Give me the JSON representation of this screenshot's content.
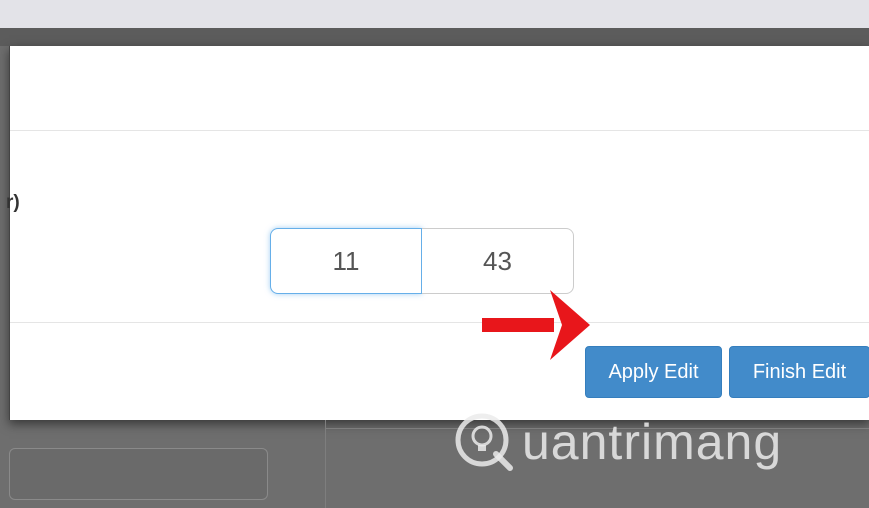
{
  "modal": {
    "side_label": "r)",
    "inputs": [
      {
        "value": "11"
      },
      {
        "value": "43"
      }
    ],
    "buttons": {
      "apply_label": "Apply Edit",
      "finish_label": "Finish Edit"
    }
  },
  "watermark": {
    "text": "uantrimang",
    "logo_icon": "q-lightbulb-icon"
  },
  "colors": {
    "button_primary": "#428bca",
    "focus_border": "#66afe9",
    "arrow": "#e8161b"
  }
}
